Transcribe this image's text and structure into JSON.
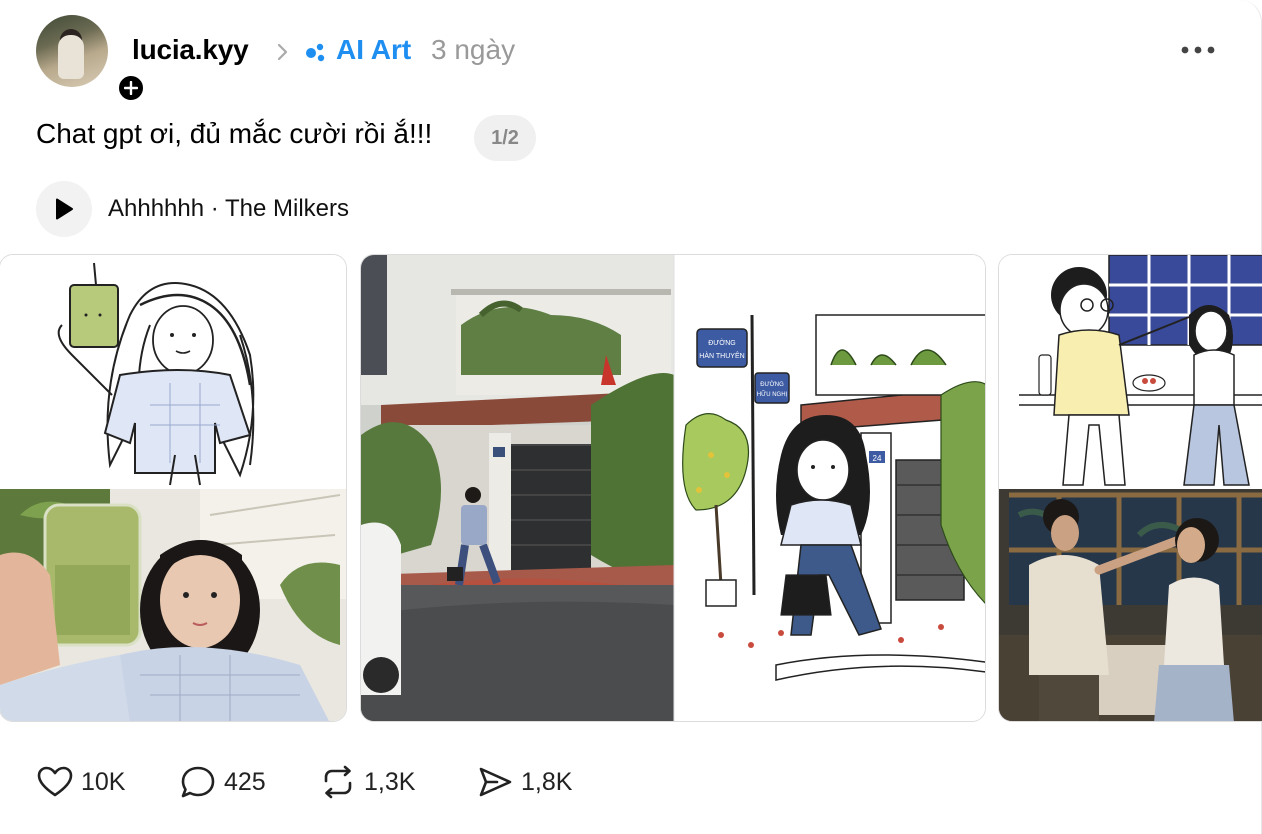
{
  "post": {
    "username": "lucia.kyy",
    "topic": "AI Art",
    "time": "3 ngày",
    "caption": "Chat gpt ơi, đủ mắc cười rồi ắ!!!",
    "pager": "1/2"
  },
  "music": {
    "label": "Ahhhhhh · The Milkers"
  },
  "media": {
    "images": [
      {
        "name": "drawing-girl-with-matcha-drink-and-selfie"
      },
      {
        "name": "photo-girl-on-street-corner-with-drawing"
      },
      {
        "name": "drawing-couple-in-kitchen-and-photo"
      }
    ],
    "street_sign_1": "ĐƯỜNG HÀN THUYÊN",
    "street_sign_2": "ĐƯỜNG HỮU NGHỊ",
    "house_number": "24"
  },
  "actions": {
    "likes": "10K",
    "comments": "425",
    "reposts": "1,3K",
    "shares": "1,8K"
  },
  "colors": {
    "accent": "#1e8ef0",
    "muted": "#999999"
  },
  "icons": [
    "plus-icon",
    "chevron-right-icon",
    "topic-dots-icon",
    "more-icon",
    "play-icon",
    "heart-icon",
    "comment-icon",
    "repost-icon",
    "share-icon"
  ]
}
